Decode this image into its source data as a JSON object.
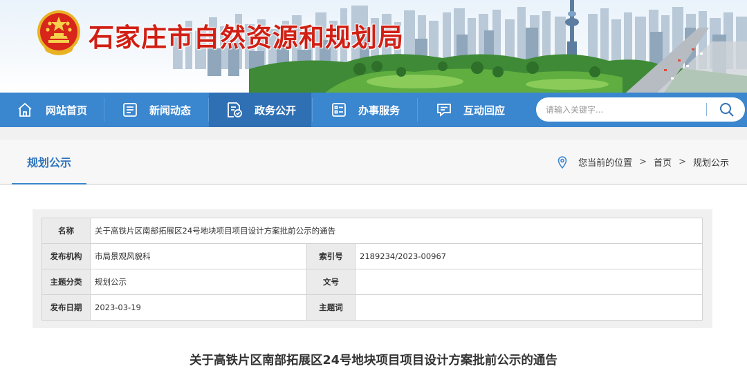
{
  "header": {
    "site_title": "石家庄市自然资源和规划局",
    "emblem_icon": "national-emblem-icon",
    "title_color": "#d01f14"
  },
  "nav": {
    "bar_color": "#3a86cf",
    "items": [
      {
        "label": "网站首页",
        "icon": "home-icon"
      },
      {
        "label": "新闻动态",
        "icon": "newspaper-icon"
      },
      {
        "label": "政务公开",
        "icon": "document-seal-icon",
        "active": true
      },
      {
        "label": "办事服务",
        "icon": "service-list-icon"
      },
      {
        "label": "互动回应",
        "icon": "chat-icon"
      }
    ]
  },
  "search": {
    "placeholder": "请输入关键字...",
    "icon": "search-icon"
  },
  "section": {
    "tab_label": "规划公示",
    "accent_color": "#2e73bd"
  },
  "breadcrumb": {
    "location_label": "您当前的位置",
    "separator": ">",
    "home": "首页",
    "current": "规划公示",
    "icon": "location-pin-icon"
  },
  "info_table": {
    "name_label": "名称",
    "name_value": "关于高铁片区南部拓展区24号地块项目项目设计方案批前公示的通告",
    "publisher_label": "发布机构",
    "publisher_value": "市局景观风貌科",
    "index_label": "索引号",
    "index_value": "2189234/2023-00967",
    "category_label": "主题分类",
    "category_value": "规划公示",
    "doc_no_label": "文号",
    "doc_no_value": "",
    "date_label": "发布日期",
    "date_value": "2023-03-19",
    "keywords_label": "主题词",
    "keywords_value": ""
  },
  "article": {
    "title": "关于高铁片区南部拓展区24号地块项目项目设计方案批前公示的通告"
  }
}
